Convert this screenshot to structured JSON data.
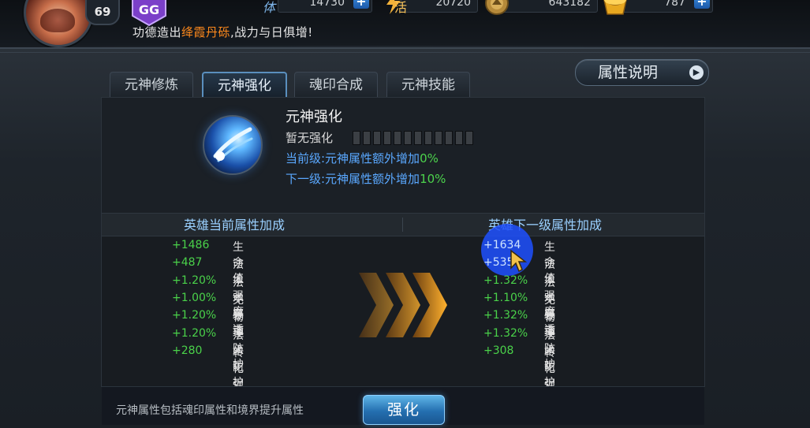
{
  "hud": {
    "level": "69",
    "resources": [
      {
        "name": "stamina",
        "label_fragment": "体",
        "value": "14730"
      },
      {
        "name": "activity",
        "label_fragment": "活",
        "value": "20720"
      },
      {
        "name": "coins",
        "value": "643182"
      },
      {
        "name": "gold",
        "value": "787"
      }
    ],
    "ticker_prefix": "功德造出",
    "ticker_highlight": "绛霞丹砾",
    "ticker_suffix": ",战力与日俱增!"
  },
  "tabs": [
    {
      "label": "元神修炼",
      "active": false
    },
    {
      "label": "元神强化",
      "active": true
    },
    {
      "label": "魂印合成",
      "active": false
    },
    {
      "label": "元神技能",
      "active": false
    }
  ],
  "attr_button": "属性说明",
  "skill": {
    "title": "元神强化",
    "status": "暂无强化",
    "pips_filled": 0,
    "pips_total": 12,
    "current_prefix": "当前级:元神属性额外增加",
    "current_pct": "0%",
    "next_prefix": "下一级:元神属性额外增加",
    "next_pct": "10%"
  },
  "current": {
    "header": "英雄当前属性加成",
    "rows": [
      {
        "value": "+1486",
        "name": "生命值"
      },
      {
        "value": "+487",
        "name": "法术强度"
      },
      {
        "value": "+1.20%",
        "name": "法术穿透"
      },
      {
        "value": "+1.00%",
        "name": "免暴率"
      },
      {
        "value": "+1.20%",
        "name": "物理防护"
      },
      {
        "value": "+1.20%",
        "name": "法术防护"
      },
      {
        "value": "+280",
        "name": "转化强度"
      }
    ]
  },
  "next": {
    "header": "英雄下一级属性加成",
    "rows": [
      {
        "value": "+1634",
        "name": "生命值"
      },
      {
        "value": "+535",
        "name": "法术强度"
      },
      {
        "value": "+1.32%",
        "name": "法术穿透"
      },
      {
        "value": "+1.10%",
        "name": "免暴率"
      },
      {
        "value": "+1.32%",
        "name": "物理防护"
      },
      {
        "value": "+1.32%",
        "name": "法术防护"
      },
      {
        "value": "+308",
        "name": "转化强度"
      }
    ]
  },
  "footer": {
    "note": "元神属性包括魂印属性和境界提升属性",
    "enhance_button": "强化"
  },
  "colors": {
    "accent_blue": "#5aa8ff",
    "value_green": "#4ad24a",
    "highlight_orange": "#ff8a1c"
  }
}
